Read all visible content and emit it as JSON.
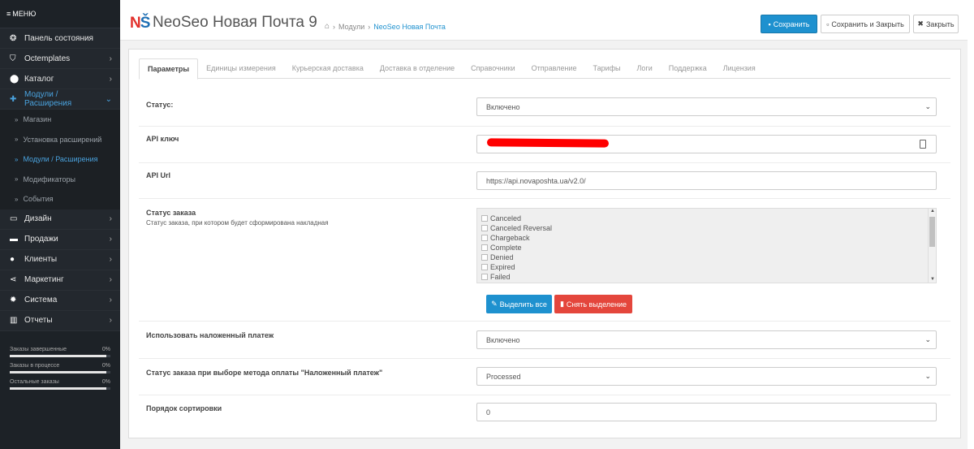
{
  "sidebar": {
    "menu_label": "МЕНЮ",
    "items": [
      {
        "label": "Панель состояния",
        "icon": "dashboard-icon",
        "glyph": "❂"
      },
      {
        "label": "Octemplates",
        "icon": "shield-icon",
        "glyph": "⛉"
      },
      {
        "label": "Каталог",
        "icon": "tag-icon",
        "glyph": "⬤"
      },
      {
        "label": "Модули / Расширения",
        "icon": "puzzle-icon",
        "glyph": "✚"
      },
      {
        "label": "Дизайн",
        "icon": "monitor-icon",
        "glyph": "▭"
      },
      {
        "label": "Продажи",
        "icon": "cart-icon",
        "glyph": "▬"
      },
      {
        "label": "Клиенты",
        "icon": "user-icon",
        "glyph": "●"
      },
      {
        "label": "Маркетинг",
        "icon": "share-icon",
        "glyph": "⋖"
      },
      {
        "label": "Система",
        "icon": "cog-icon",
        "glyph": "✹"
      },
      {
        "label": "Отчеты",
        "icon": "bar-chart-icon",
        "glyph": "▥"
      }
    ],
    "subitems": [
      {
        "label": "Магазин"
      },
      {
        "label": "Установка расширений"
      },
      {
        "label": "Модули / Расширения"
      },
      {
        "label": "Модификаторы"
      },
      {
        "label": "События"
      }
    ],
    "stats": [
      {
        "label": "Заказы завершенные",
        "value": "0%",
        "progress": 0.96
      },
      {
        "label": "Заказы в процессе",
        "value": "0%",
        "progress": 0.96
      },
      {
        "label": "Остальные заказы",
        "value": "0%",
        "progress": 0.96
      }
    ]
  },
  "header": {
    "logo_n": "N",
    "logo_s": "Š",
    "title": "NeoSeo Новая Почта 9",
    "breadcrumb": [
      {
        "label": "Модули"
      },
      {
        "label": "NeoSeo Новая Почта"
      }
    ],
    "save_label": "Сохранить",
    "save_close_label": "Сохранить и Закрыть",
    "close_label": "Закрыть"
  },
  "tabs": [
    "Параметры",
    "Единицы измерения",
    "Курьерская доставка",
    "Доставка в отделение",
    "Справочники",
    "Отправление",
    "Тарифы",
    "Логи",
    "Поддержка",
    "Лицензия"
  ],
  "form": {
    "status_label": "Статус:",
    "status_value": "Включено",
    "api_key_label": "API ключ",
    "api_url_label": "API Url",
    "api_url_value": "https://api.novaposhta.ua/v2.0/",
    "order_status_label": "Статус заказа",
    "order_status_help": "Статус заказа, при котором будет сформирована накладная",
    "order_status_options": [
      "Canceled",
      "Canceled Reversal",
      "Chargeback",
      "Complete",
      "Denied",
      "Expired",
      "Failed"
    ],
    "select_all_label": "Выделить все",
    "deselect_label": "Снять выделение",
    "cod_label": "Использовать наложенный платеж",
    "cod_value": "Включено",
    "cod_status_label": "Статус заказа при выборе метода оплаты \"Наложенный платеж\"",
    "cod_status_value": "Processed",
    "sort_label": "Порядок сортировки",
    "sort_value": "0"
  }
}
